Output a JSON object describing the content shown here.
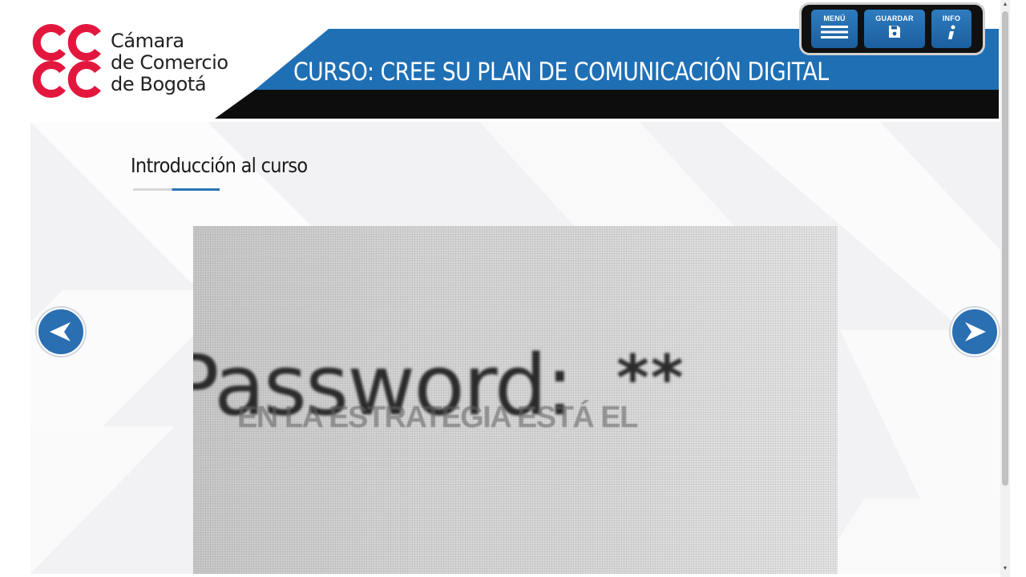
{
  "header": {
    "logo": {
      "line1": "Cámara",
      "line2": "de Comercio",
      "line3": "de Bogotá"
    },
    "course_title": "CURSO: CREE SU PLAN DE COMUNICACIÓN DIGITAL",
    "toolbar": {
      "menu_label": "MENÚ",
      "save_label": "GUARDAR",
      "info_label": "INFO",
      "menu_icon": "hamburger-icon",
      "save_icon": "floppy-disk-icon",
      "info_icon": "info-icon"
    }
  },
  "content": {
    "section_title": "Introducción al curso",
    "media": {
      "word": "Password:",
      "stars": "**",
      "overlay_text": "EN LA ESTRATEGIA ESTÁ EL"
    },
    "navigation": {
      "prev_icon": "arrow-left-icon",
      "next_icon": "arrow-right-icon"
    }
  },
  "colors": {
    "brand_red": "#e3173e",
    "brand_blue": "#1f6fb5",
    "banner_black": "#0d0d0d",
    "toolbar_black": "#101010"
  }
}
